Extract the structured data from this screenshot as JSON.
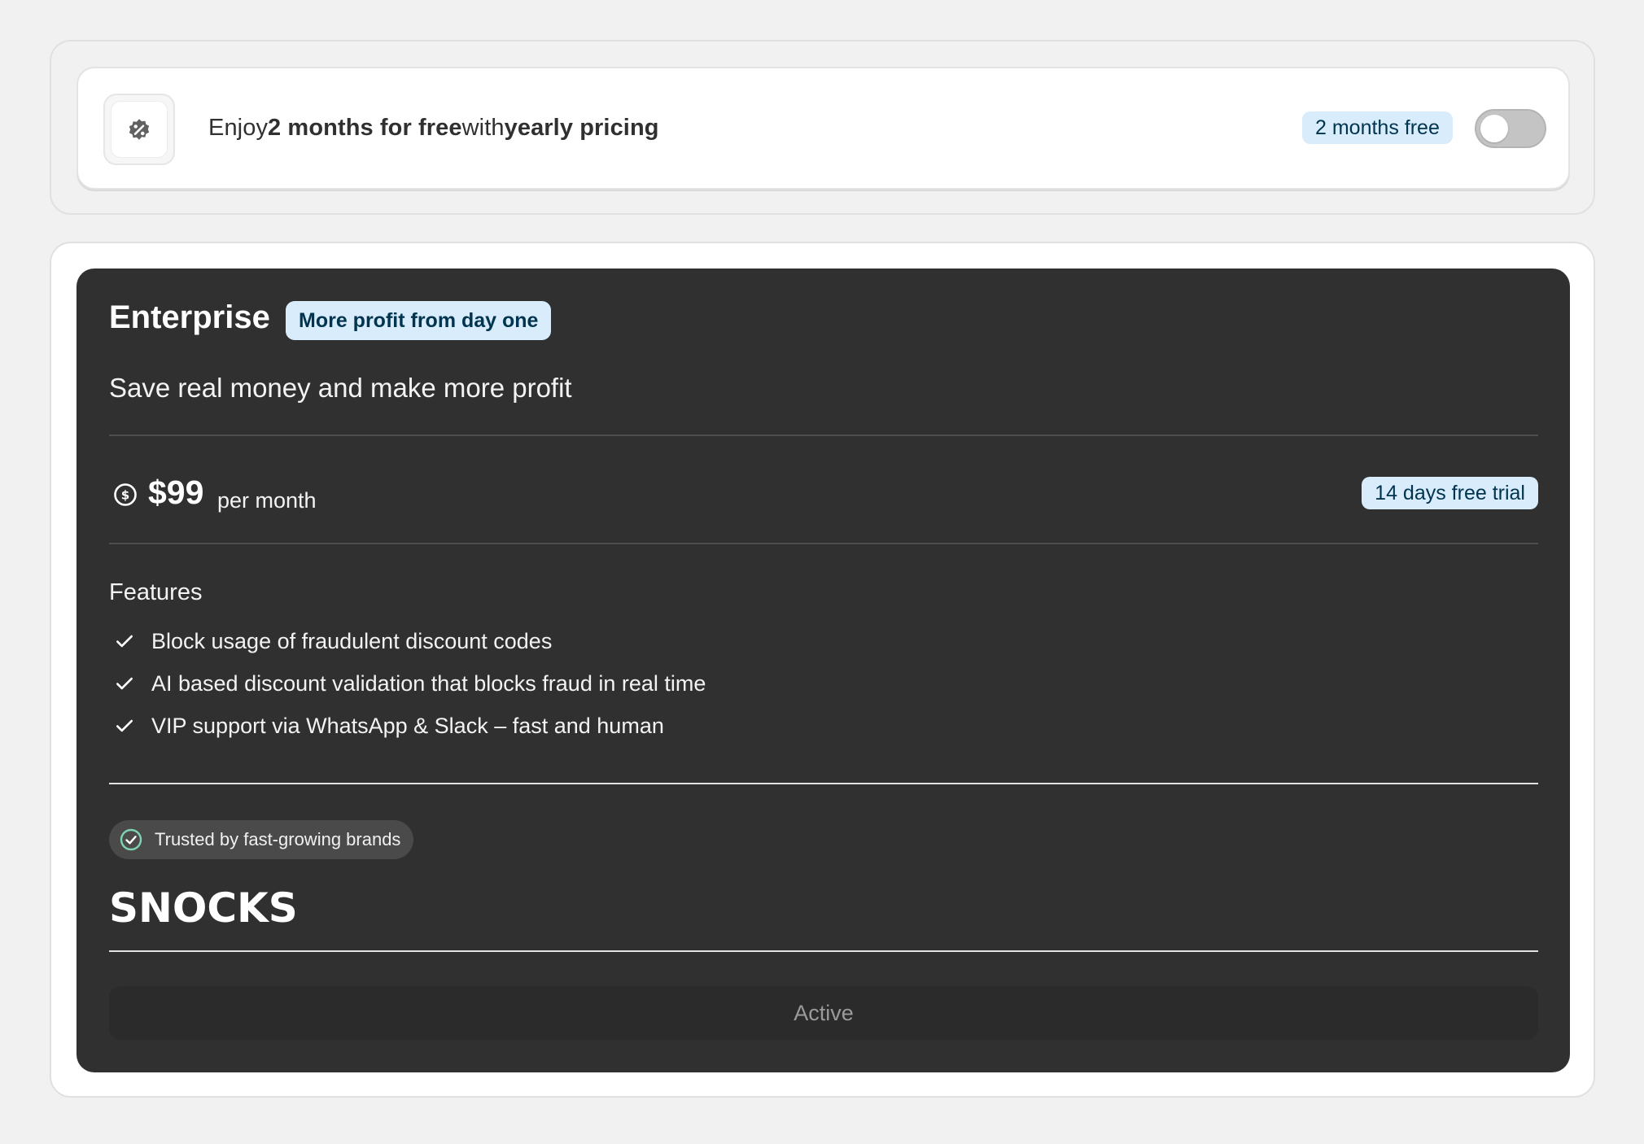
{
  "promo": {
    "text_prefix": "Enjoy ",
    "text_strong_1": "2 months for free",
    "text_middle": " with ",
    "text_strong_2": "yearly pricing",
    "badge": "2 months free",
    "toggle_on": false,
    "icon": "discount-badge-icon"
  },
  "plan": {
    "title": "Enterprise",
    "badge": "More profit from day one",
    "subtitle": "Save real money and make more profit",
    "price": {
      "amount": "$99",
      "period": "per month",
      "icon": "dollar-circle-icon"
    },
    "trial_badge": "14 days free trial",
    "features_title": "Features",
    "features": [
      "Block usage of fraudulent discount codes",
      "AI based discount validation that blocks fraud in real time",
      "VIP support via WhatsApp & Slack – fast and human"
    ],
    "trust_label": "Trusted by fast-growing brands",
    "brand_logo": "SNOCKS",
    "action_label": "Active"
  },
  "colors": {
    "card_dark": "#303030",
    "badge_bg": "#d8ecfb",
    "badge_text": "#00344f",
    "trust_check": "#7fd3b0"
  }
}
